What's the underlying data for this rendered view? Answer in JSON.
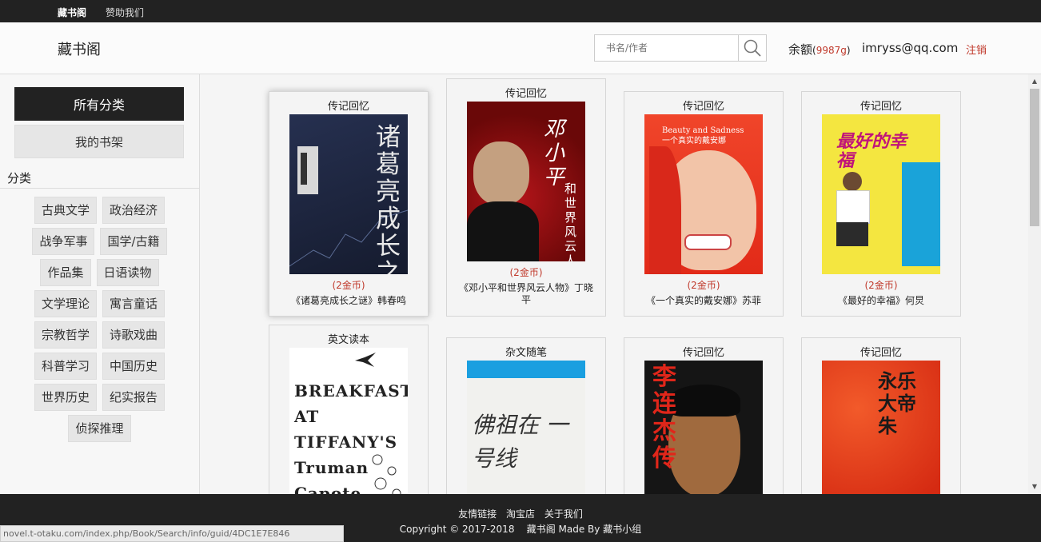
{
  "topbar": {
    "site_name": "藏书阁",
    "sponsor": "赞助我们"
  },
  "header": {
    "logo": "藏书阁",
    "search_placeholder": "书名/作者",
    "balance_label": "余额",
    "balance_open": "(",
    "balance_amount": "9987g",
    "balance_close": ")",
    "user_email": "imryss@qq.com",
    "logout": "注销"
  },
  "sidebar": {
    "all_categories": "所有分类",
    "my_shelf": "我的书架",
    "category_heading": "分类",
    "tag_rows": [
      [
        "古典文学",
        "政治经济"
      ],
      [
        "战争军事",
        "国学/古籍"
      ],
      [
        "作品集",
        "日语读物"
      ],
      [
        "文学理论",
        "寓言童话"
      ],
      [
        "宗教哲学",
        "诗歌戏曲"
      ],
      [
        "科普学习",
        "中国历史"
      ],
      [
        "世界历史",
        "纪实报告"
      ],
      [
        "侦探推理"
      ]
    ]
  },
  "books": [
    {
      "category": "传记回忆",
      "price": "(2金币)",
      "title": "《诸葛亮成长之谜》韩春鸣",
      "cover_text": "诸葛亮成长之谜"
    },
    {
      "category": "传记回忆",
      "price": "(2金币)",
      "title": "《邓小平和世界风云人物》丁晓平",
      "cover_text": "和世界风云人"
    },
    {
      "category": "传记回忆",
      "price": "(2金币)",
      "title": "《一个真实的戴安娜》苏菲",
      "cover_text": "Beauty and Sadness 一个真实的戴安娜"
    },
    {
      "category": "传记回忆",
      "price": "(2金币)",
      "title": "《最好的幸福》何炅",
      "cover_text": "最好的幸福"
    },
    {
      "category": "英文读本",
      "price": "",
      "title": "",
      "cover_text": "BREAKFAST AT TIFFANY'S Truman Capote"
    },
    {
      "category": "杂文随笔",
      "price": "",
      "title": "",
      "cover_text": ""
    },
    {
      "category": "传记回忆",
      "price": "",
      "title": "",
      "cover_text": "李连杰传"
    },
    {
      "category": "传记回忆",
      "price": "",
      "title": "",
      "cover_text": "永乐大帝 朱"
    }
  ],
  "footer": {
    "links": [
      "友情链接",
      "淘宝店",
      "关于我们"
    ],
    "copyright": "Copyright © 2017-2018    藏书阁 Made By 藏书小组"
  },
  "status_url": "novel.t-otaku.com/index.php/Book/Search/info/guid/4DC1E7E846",
  "colors": {
    "accent_red": "#c0392b",
    "dark_bar": "#222222"
  }
}
